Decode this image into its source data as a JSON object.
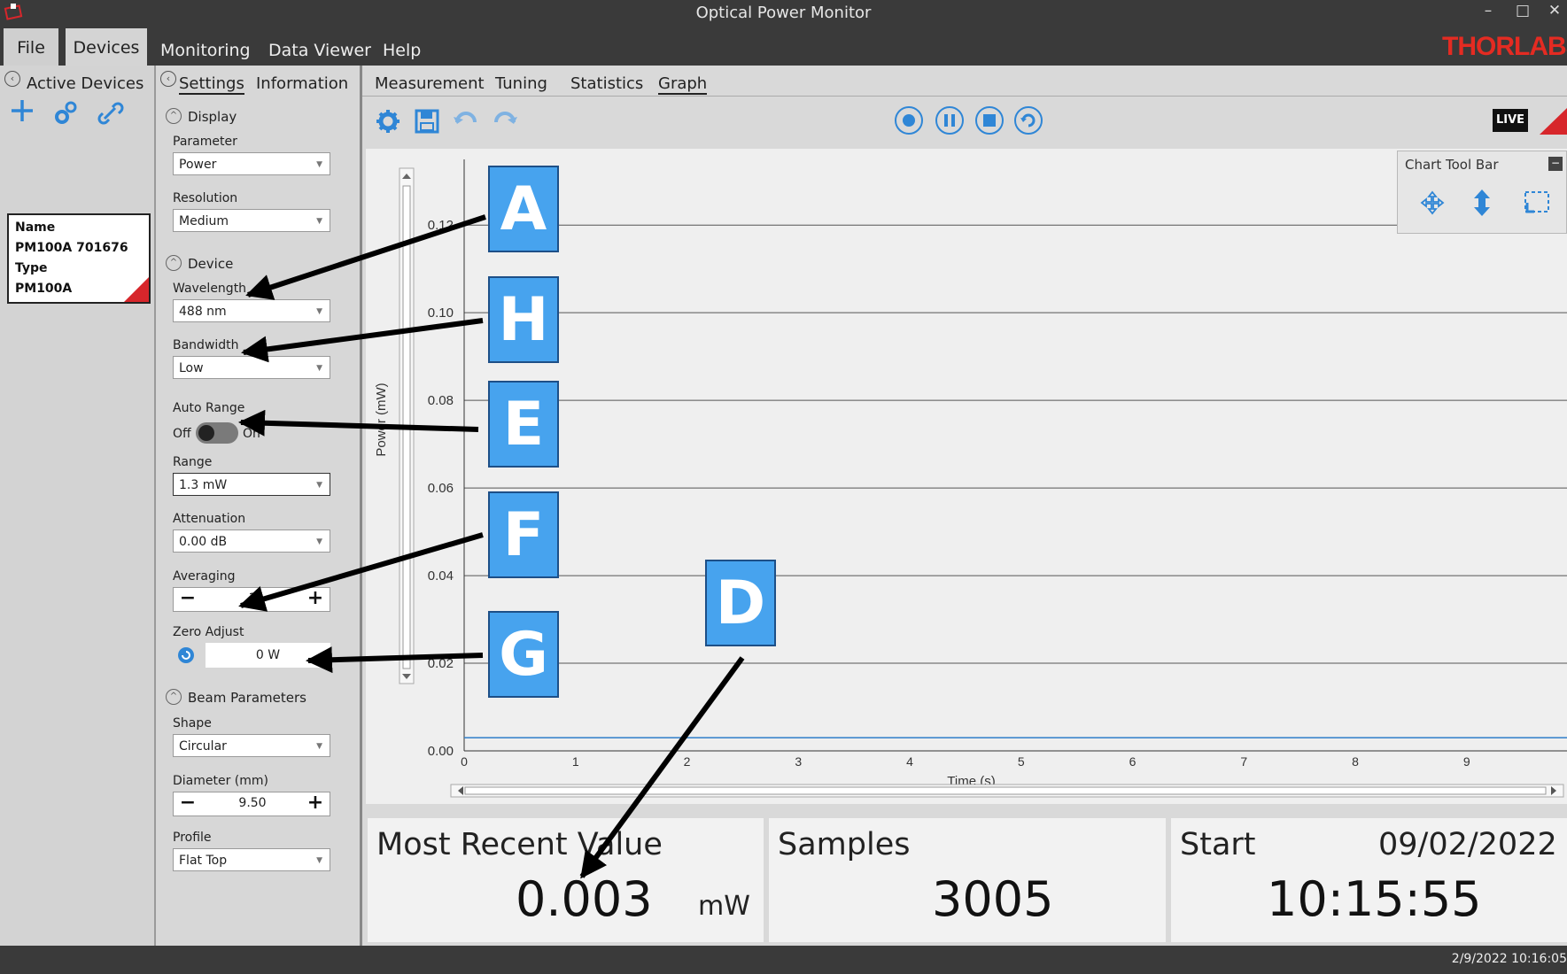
{
  "window": {
    "title": "Optical Power Monitor",
    "minimize": "–",
    "maximize": "□",
    "close": "✕"
  },
  "menu": {
    "items": [
      "File",
      "Devices",
      "Monitoring",
      "Data Viewer",
      "Help"
    ],
    "brand": "THORLABS"
  },
  "left_panel": {
    "title": "Active Devices",
    "icons": [
      "add-icon",
      "configure-icon",
      "link-icon"
    ],
    "device": {
      "name_label": "Name",
      "name": "PM100A 701676",
      "type_label": "Type",
      "type": "PM100A"
    }
  },
  "settings": {
    "tabs": [
      "Settings",
      "Information"
    ],
    "display": {
      "header": "Display",
      "parameter_label": "Parameter",
      "parameter": "Power",
      "resolution_label": "Resolution",
      "resolution": "Medium"
    },
    "device": {
      "header": "Device",
      "wavelength_label": "Wavelength",
      "wavelength": "488 nm",
      "bandwidth_label": "Bandwidth",
      "bandwidth": "Low",
      "autorange_label": "Auto Range",
      "autorange_off": "Off",
      "autorange_on": "On",
      "range_label": "Range",
      "range": "1.3 mW",
      "attenuation_label": "Attenuation",
      "attenuation": "0.00 dB",
      "averaging_label": "Averaging",
      "averaging": "1",
      "zero_label": "Zero Adjust",
      "zero": "0 W"
    },
    "beam": {
      "header": "Beam Parameters",
      "shape_label": "Shape",
      "shape": "Circular",
      "diameter_label": "Diameter (mm)",
      "diameter": "9.50",
      "profile_label": "Profile",
      "profile": "Flat Top"
    }
  },
  "main": {
    "tabs": [
      "Measurement",
      "Tuning",
      "Statistics",
      "Graph"
    ],
    "toolbar_icons": [
      "settings-icon",
      "save-icon",
      "undo-icon",
      "redo-icon"
    ],
    "controls": [
      "record-button",
      "pause-button",
      "stop-button",
      "refresh-button"
    ],
    "live": "LIVE",
    "chart_toolbar": {
      "title": "Chart Tool Bar",
      "icons": [
        "pan-icon",
        "vertical-zoom-icon",
        "box-zoom-icon"
      ]
    }
  },
  "chart_data": {
    "type": "line",
    "xlabel": "Time (s)",
    "ylabel": "Power (mW)",
    "xlim": [
      0,
      9.9
    ],
    "ylim": [
      0,
      0.135
    ],
    "x_ticks": [
      "0",
      "1",
      "2",
      "3",
      "4",
      "5",
      "6",
      "7",
      "8",
      "9"
    ],
    "y_ticks": [
      "0.00",
      "0.02",
      "0.04",
      "0.06",
      "0.08",
      "0.10",
      "0.12"
    ],
    "grid": true,
    "series": [
      {
        "x": [
          0,
          9.9
        ],
        "values": [
          0.003,
          0.003
        ],
        "color": "#2f7ec9"
      }
    ]
  },
  "metrics": {
    "recent": {
      "title": "Most Recent Value",
      "value": "0.003",
      "unit": "mW"
    },
    "samples": {
      "title": "Samples",
      "value": "3005"
    },
    "start": {
      "title": "Start",
      "date": "09/02/2022",
      "time": "10:15:55"
    }
  },
  "annotations": {
    "labels": [
      "A",
      "H",
      "E",
      "F",
      "G",
      "D"
    ]
  },
  "status": {
    "datetime": "2/9/2022 10:16:05"
  }
}
